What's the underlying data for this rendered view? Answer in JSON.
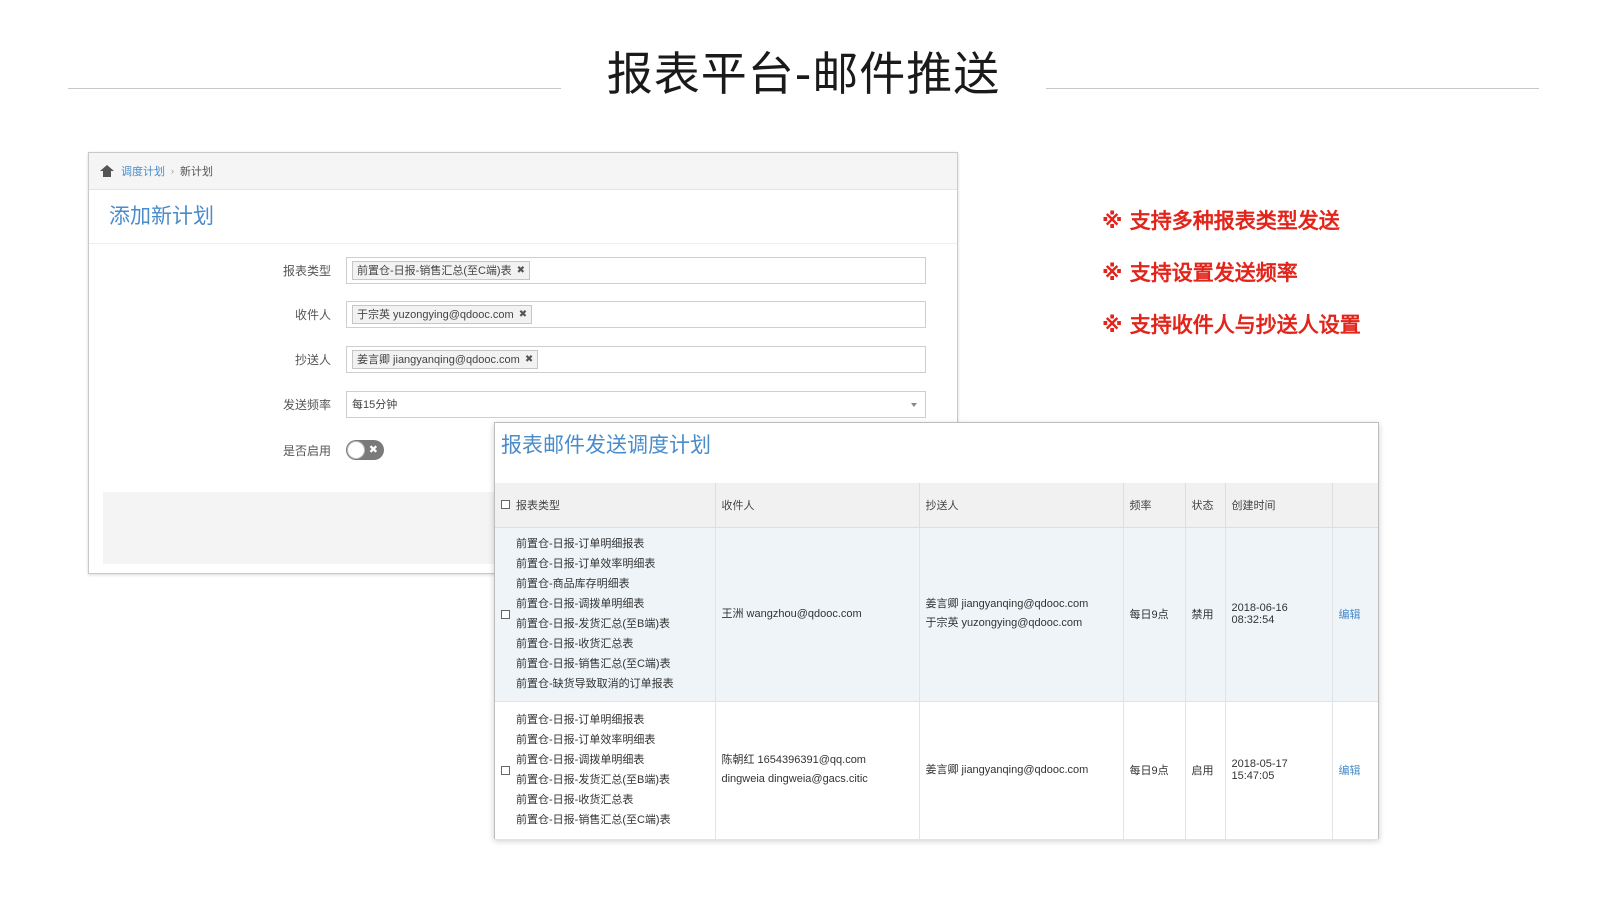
{
  "slide": {
    "title": "报表平台-邮件推送"
  },
  "features": [
    "※ 支持多种报表类型发送",
    "※ 支持设置发送频率",
    "※ 支持收件人与抄送人设置"
  ],
  "form_window": {
    "breadcrumb": {
      "link": "调度计划",
      "current": "新计划"
    },
    "title": "添加新计划",
    "fields": {
      "report_type": {
        "label": "报表类型",
        "tag": "前置仓-日报-销售汇总(至C端)表"
      },
      "recipient": {
        "label": "收件人",
        "tag": "于宗英 yuzongying@qdooc.com"
      },
      "cc": {
        "label": "抄送人",
        "tag": "姜言卿 jiangyanqing@qdooc.com"
      },
      "frequency": {
        "label": "发送频率",
        "value": "每15分钟"
      },
      "enabled": {
        "label": "是否启用"
      }
    },
    "tag_remove_glyph": "✖",
    "toggle_off_glyph": "✖"
  },
  "table_window": {
    "title": "报表邮件发送调度计划",
    "columns": {
      "report_type": "报表类型",
      "recipient": "收件人",
      "cc": "抄送人",
      "frequency": "频率",
      "status": "状态",
      "created": "创建时间"
    },
    "rows": [
      {
        "report_types": [
          "前置仓-日报-订单明细报表",
          "前置仓-日报-订单效率明细表",
          "前置仓-商品库存明细表",
          "前置仓-日报-调拨单明细表",
          "前置仓-日报-发货汇总(至B端)表",
          "前置仓-日报-收货汇总表",
          "前置仓-日报-销售汇总(至C端)表",
          "前置仓-缺货导致取消的订单报表"
        ],
        "recipients": [
          "王洲 wangzhou@qdooc.com"
        ],
        "cc": [
          "姜言卿 jiangyanqing@qdooc.com",
          "于宗英 yuzongying@qdooc.com"
        ],
        "frequency": "每日9点",
        "status": "禁用",
        "created": "2018-06-16 08:32:54",
        "action": "编辑"
      },
      {
        "report_types": [
          "前置仓-日报-订单明细报表",
          "前置仓-日报-订单效率明细表",
          "前置仓-日报-调拨单明细表",
          "前置仓-日报-发货汇总(至B端)表",
          "前置仓-日报-收货汇总表",
          "前置仓-日报-销售汇总(至C端)表"
        ],
        "recipients": [
          "陈朝红 1654396391@qq.com",
          "dingweia dingweia@gacs.citic"
        ],
        "cc": [
          "姜言卿 jiangyanqing@qdooc.com"
        ],
        "frequency": "每日9点",
        "status": "启用",
        "created": "2018-05-17 15:47:05",
        "action": "编辑"
      }
    ]
  }
}
